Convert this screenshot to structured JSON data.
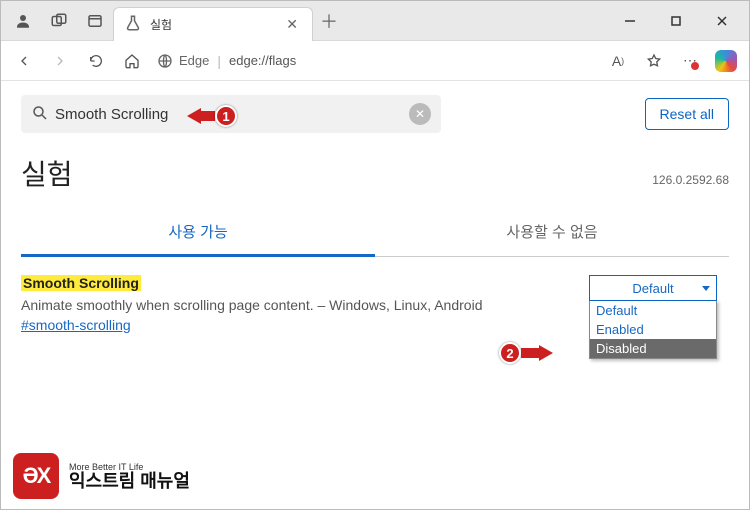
{
  "window": {
    "tab_title": "실험",
    "address": {
      "browser_label": "Edge",
      "url": "edge://flags"
    }
  },
  "flags_page": {
    "search_value": "Smooth Scrolling",
    "reset_label": "Reset all",
    "heading": "실험",
    "version": "126.0.2592.68",
    "tab_available": "사용 가능",
    "tab_unavailable": "사용할 수 없음",
    "flag": {
      "name": "Smooth Scrolling",
      "description": "Animate smoothly when scrolling page content. – Windows, Linux, Android",
      "anchor": "#smooth-scrolling",
      "selected": "Default",
      "options": [
        "Default",
        "Enabled",
        "Disabled"
      ]
    }
  },
  "annotations": {
    "badge1": "1",
    "badge2": "2"
  },
  "watermark": {
    "tagline": "More Better IT Life",
    "brand": "익스트림 매뉴얼"
  }
}
